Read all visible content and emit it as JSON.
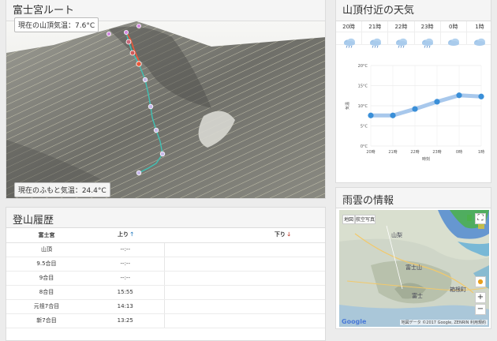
{
  "route": {
    "title": "富士宮ルート",
    "summit_temp": "現在の山頂気温：7.6°C",
    "base_temp": "現在のふもと気温：24.4°C"
  },
  "history": {
    "title": "登山履歴",
    "headers": {
      "station": "富士宮",
      "up": "上り",
      "down": "下り"
    },
    "rows": [
      {
        "station": "山頂",
        "up": "--:--",
        "down": ""
      },
      {
        "station": "9.5合目",
        "up": "--:--",
        "down": ""
      },
      {
        "station": "9合目",
        "up": "--:--",
        "down": ""
      },
      {
        "station": "8合目",
        "up": "15:55",
        "down": ""
      },
      {
        "station": "元祖7合目",
        "up": "14:13",
        "down": ""
      },
      {
        "station": "新7合目",
        "up": "13:25",
        "down": ""
      }
    ]
  },
  "weather": {
    "title": "山頂付近の天気",
    "forecast": [
      {
        "time": "20時",
        "icon": "rain-cloud-icon"
      },
      {
        "time": "21時",
        "icon": "rain-cloud-icon"
      },
      {
        "time": "22時",
        "icon": "rain-cloud-icon"
      },
      {
        "time": "23時",
        "icon": "rain-cloud-icon"
      },
      {
        "time": "0時",
        "icon": "cloud-icon"
      },
      {
        "time": "1時",
        "icon": "cloud-icon"
      }
    ],
    "accent": "#3a8fd8"
  },
  "chart_data": {
    "type": "line",
    "categories": [
      "20時",
      "21時",
      "22時",
      "23時",
      "0時",
      "1時"
    ],
    "values": [
      7.6,
      7.6,
      9.2,
      11.0,
      12.6,
      12.3
    ],
    "xlabel": "時刻",
    "ylabel": "気温",
    "ylim": [
      0,
      20
    ],
    "yticks": [
      "0°C",
      "5°C",
      "10°C",
      "15°C",
      "20°C"
    ],
    "grid": true
  },
  "rain": {
    "title": "雨雲の情報",
    "map_type_1": "地図",
    "map_type_2": "航空写真",
    "zoom_in": "+",
    "zoom_out": "−",
    "attribution": "地図データ ©2017 Google, ZENRIN  利用規約",
    "google": "Google",
    "places": [
      "山梨",
      "富士山",
      "箱根町",
      "富士"
    ]
  }
}
